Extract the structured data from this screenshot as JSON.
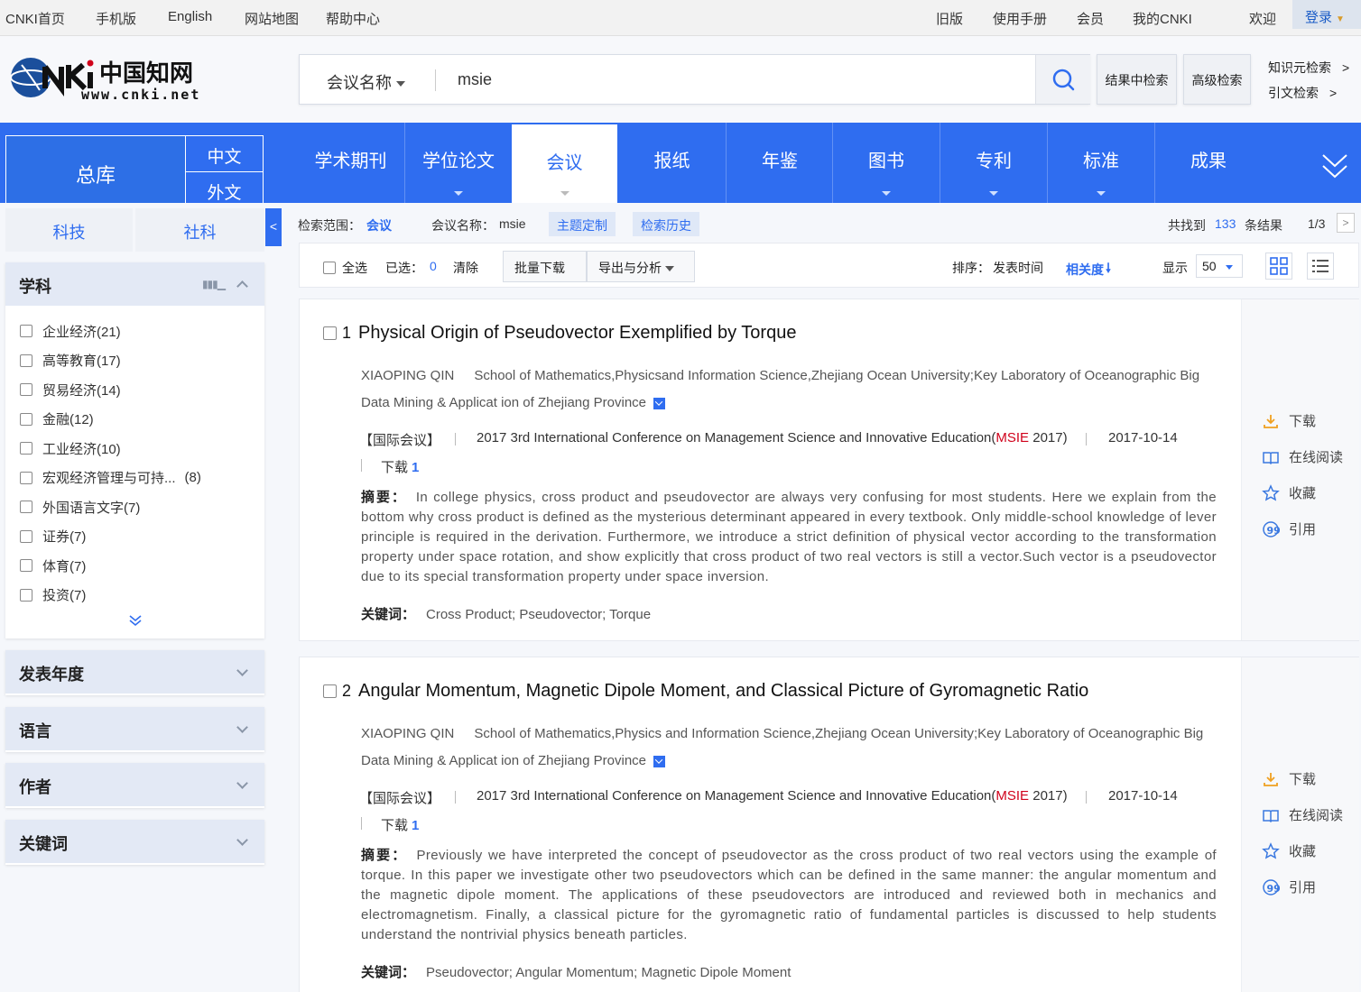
{
  "topbar": {
    "left": [
      "CNKI首页",
      "手机版",
      "English",
      "网站地图",
      "帮助中心"
    ],
    "right": [
      "旧版",
      "使用手册",
      "会员",
      "我的CNKI",
      "欢迎"
    ],
    "login": "登录"
  },
  "logo": {
    "text": "www.cnki.net"
  },
  "search": {
    "scope": "会议名称",
    "query": "msie",
    "result_search": "结果中检索",
    "advanced": "高级检索",
    "knowledge": "知识元检索",
    "citation": "引文检索",
    "arrow": ">"
  },
  "nav": {
    "zongku": "总库",
    "zh": "中文",
    "en": "外文",
    "items": [
      "学术期刊",
      "学位论文",
      "会议",
      "报纸",
      "年鉴",
      "图书",
      "专利",
      "标准",
      "成果"
    ],
    "active": "会议"
  },
  "sidebar": {
    "tabs": [
      "科技",
      "社科"
    ],
    "collapse_icon": "<",
    "subject": {
      "title": "学科",
      "items": [
        "企业经济(21)",
        "高等教育(17)",
        "贸易经济(14)",
        "金融(12)",
        "工业经济(10)",
        "宏观经济管理与可持...",
        "外国语言文字(7)",
        "证券(7)",
        "体育(7)",
        "投资(7)"
      ],
      "item6_count": "(8)"
    },
    "facets": [
      "发表年度",
      "语言",
      "作者",
      "关键词"
    ]
  },
  "filter": {
    "scope_label": "检索范围：",
    "scope_value": "会议",
    "name_label": "会议名称：",
    "name_value": "msie",
    "theme_btn": "主题定制",
    "history_btn": "检索历史",
    "found_prefix": "共找到",
    "found_count": "133",
    "found_suffix": "条结果",
    "page": "1/3",
    "next": ">"
  },
  "toolbar": {
    "select_all": "全选",
    "selected_label": "已选：",
    "selected_count": "0",
    "clear": "清除",
    "batch_download": "批量下载",
    "export": "导出与分析",
    "sort_label": "排序：",
    "sort_time": "发表时间",
    "sort_relevance": "相关度",
    "display_label": "显示",
    "display_value": "50"
  },
  "results": [
    {
      "num": "1",
      "title": "Physical Origin of Pseudovector Exemplified by Torque",
      "author": "XIAOPING QIN",
      "affiliation": "School of Mathematics,Physicsand Information Science,Zhejiang Ocean University;Key Laboratory of Oceanographic Big Data Mining & Applicat ion of Zhejiang Province",
      "type": "【国际会议】",
      "conf_prefix": "2017 3rd International Conference on Management Science and Innovative Education(",
      "conf_highlight": "MSIE",
      "conf_suffix": " 2017)",
      "date": "2017-10-14",
      "download_label": "下载",
      "download_count": "1",
      "abstract_label": "摘要：",
      "abstract": "In college physics, cross product and pseudovector are always very confusing for most students. Here we explain from the bottom why cross product is defined as the mysterious determinant appeared in every textbook. Only middle-school knowledge of lever principle is required in the derivation. Furthermore, we introduce a strict definition of physical vector according to the transformation property under space rotation, and show explicitly that cross product of two real vectors is still a vector.Such vector is a pseudovector due to its special transformation property under space inversion.",
      "keywords_label": "关键词：",
      "keywords": "Cross Product; Pseudovector; Torque"
    },
    {
      "num": "2",
      "title": "Angular Momentum, Magnetic Dipole Moment, and Classical Picture of Gyromagnetic Ratio",
      "author": "XIAOPING QIN",
      "affiliation": "School of Mathematics,Physics and Information Science,Zhejiang Ocean University;Key Laboratory of Oceanographic Big Data Mining & Applicat ion of Zhejiang Province",
      "type": "【国际会议】",
      "conf_prefix": "2017 3rd International Conference on Management Science and Innovative Education(",
      "conf_highlight": "MSIE",
      "conf_suffix": " 2017)",
      "date": "2017-10-14",
      "download_label": "下载",
      "download_count": "1",
      "abstract_label": "摘要：",
      "abstract": "Previously we have interpreted the concept of pseudovector as the cross product of two real vectors using the example of torque. In this paper we investigate other two pseudovectors which can be defined in the same manner: the angular momentum and the magnetic dipole moment. The applications of these pseudovectors are introduced and reviewed both in mechanics and electromagnetism. Finally, a classical picture for the gyromagnetic ratio of fundamental particles is discussed to help students understand the nontrivial physics beneath particles.",
      "keywords_label": "关键词：",
      "keywords": "Pseudovector; Angular Momentum; Magnetic Dipole Moment"
    }
  ],
  "ops": [
    "下载",
    "在线阅读",
    "收藏",
    "引用"
  ],
  "colors": {
    "brand_blue": "#2f6df0",
    "highlight_red": "#d0021b",
    "download_orange": "#f0a020"
  }
}
